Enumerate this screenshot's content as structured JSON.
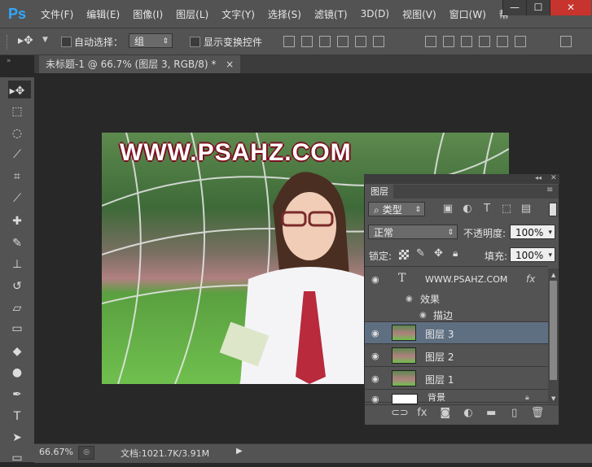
{
  "app": {
    "logo": "Ps"
  },
  "menu": [
    "文件(F)",
    "编辑(E)",
    "图像(I)",
    "图层(L)",
    "文字(Y)",
    "选择(S)",
    "滤镜(T)",
    "3D(D)",
    "视图(V)",
    "窗口(W)",
    "帮"
  ],
  "window_controls": {
    "minimize": "—",
    "maximize": "☐",
    "close": "✕"
  },
  "options": {
    "auto_select_label": "自动选择：",
    "auto_select_value": "组",
    "show_transform_label": "显示变换控件"
  },
  "document": {
    "tab_title": "未标题-1 @ 66.7% (图层 3, RGB/8) *",
    "tab_close": "×",
    "watermark": "WWW.PSAHZ.COM"
  },
  "status": {
    "zoom": "66.67%",
    "doc_info": "文档:1021.7K/3.91M"
  },
  "layers_panel": {
    "tab": "图层",
    "filter_kind": "类型",
    "blend_mode": "正常",
    "opacity_label": "不透明度:",
    "opacity_value": "100%",
    "lock_label": "锁定:",
    "fill_label": "填充:",
    "fill_value": "100%",
    "text_layer": "WWW.PSAHZ.COM",
    "effects_label": "效果",
    "stroke_label": "描边",
    "layers": [
      "图层 3",
      "图层 2",
      "图层 1"
    ],
    "background_label": "背景",
    "fx_badge": "fx"
  },
  "colors": {
    "accent": "#31a8ff",
    "selected_row": "#5f6f82",
    "close_button": "#c7332d"
  }
}
